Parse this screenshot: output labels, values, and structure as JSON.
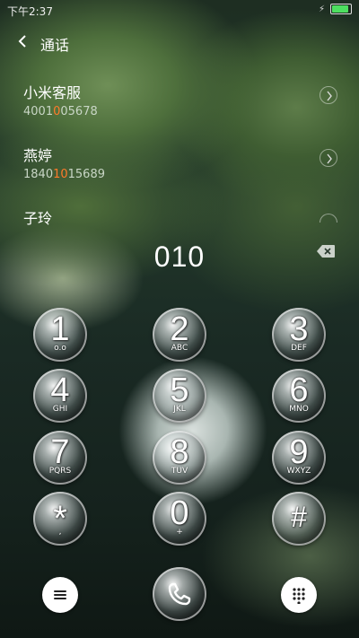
{
  "status_bar": {
    "time": "下午2:37",
    "charging_icon": "bolt-icon",
    "battery_icon": "battery-icon"
  },
  "header": {
    "title": "通话",
    "back_icon": "chevron-left-icon"
  },
  "contacts": [
    {
      "name": "小米客服",
      "number_prefix": "4001",
      "number_match": "0",
      "number_suffix": "05678"
    },
    {
      "name": "燕婷",
      "number_prefix": "1840",
      "number_match": "10",
      "number_suffix": "15689"
    },
    {
      "name": "子玲",
      "number_prefix": "",
      "number_match": "",
      "number_suffix": ""
    }
  ],
  "dial": {
    "input": "010",
    "backspace_icon": "backspace-icon"
  },
  "keys": [
    {
      "digit": "1",
      "letters": "o.o"
    },
    {
      "digit": "2",
      "letters": "ABC"
    },
    {
      "digit": "3",
      "letters": "DEF"
    },
    {
      "digit": "4",
      "letters": "GHI"
    },
    {
      "digit": "5",
      "letters": "JKL"
    },
    {
      "digit": "6",
      "letters": "MNO"
    },
    {
      "digit": "7",
      "letters": "PQRS"
    },
    {
      "digit": "8",
      "letters": "TUV"
    },
    {
      "digit": "9",
      "letters": "WXYZ"
    },
    {
      "digit": "*",
      "letters": ","
    },
    {
      "digit": "0",
      "letters": "+"
    },
    {
      "digit": "#",
      "letters": ""
    }
  ],
  "bottom": {
    "menu_icon": "menu-icon",
    "call_icon": "phone-icon",
    "keypad_icon": "keypad-icon"
  },
  "colors": {
    "match_highlight": "#ff7a2a",
    "battery": "#4ddf60"
  }
}
